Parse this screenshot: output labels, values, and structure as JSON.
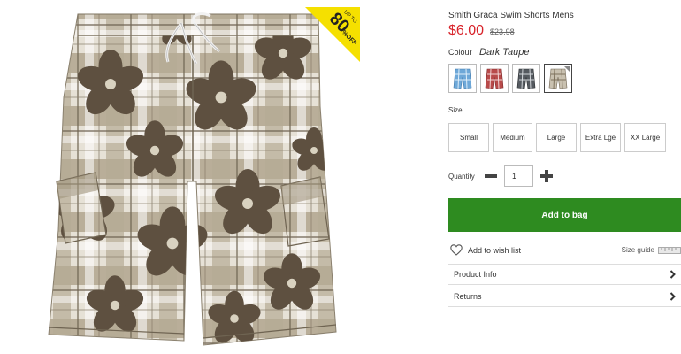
{
  "product": {
    "title": "Smith Graca Swim Shorts Mens",
    "price": "$6.00",
    "old_price": "$23.98",
    "badge": {
      "line1": "UP TO",
      "line2": "80",
      "line3": "%OFF",
      "color": "#f5e000"
    }
  },
  "colour": {
    "label": "Colour",
    "selected": "Dark Taupe",
    "swatches": [
      {
        "name": "Blue",
        "color": "#6ea8d8"
      },
      {
        "name": "Red",
        "color": "#b84a4a"
      },
      {
        "name": "Charcoal",
        "color": "#555a60"
      },
      {
        "name": "Dark Taupe",
        "color": "#8a7f6a",
        "selected": true
      }
    ]
  },
  "size": {
    "label": "Size",
    "options": [
      "Small",
      "Medium",
      "Large",
      "Extra Lge",
      "XX Large"
    ]
  },
  "quantity": {
    "label": "Quantity",
    "value": "1"
  },
  "actions": {
    "add_to_bag": "Add to bag",
    "add_to_wishlist": "Add to wish list",
    "size_guide": "Size guide"
  },
  "accordions": [
    {
      "label": "Product Info"
    },
    {
      "label": "Returns"
    }
  ],
  "colors": {
    "price_red": "#d8232a",
    "add_button_green": "#2e8b20"
  }
}
